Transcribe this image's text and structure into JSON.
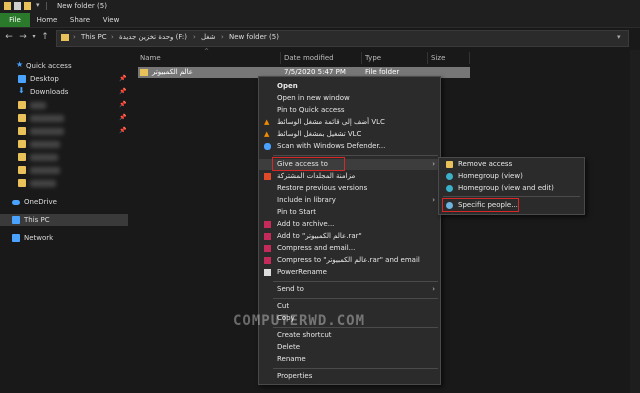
{
  "window": {
    "title": "New folder (5)"
  },
  "ribbon": {
    "tabs": [
      "File",
      "Home",
      "Share",
      "View"
    ]
  },
  "address": {
    "crumbs": [
      "This PC",
      "وحدة تخزين جديدة (F:)",
      "شغل",
      "New folder (5)"
    ]
  },
  "nav": {
    "quick_access": "Quick access",
    "desktop": "Desktop",
    "downloads": "Downloads",
    "onedrive": "OneDrive",
    "this_pc": "This PC",
    "network": "Network"
  },
  "columns": {
    "name": "Name",
    "date": "Date modified",
    "type": "Type",
    "size": "Size"
  },
  "file": {
    "name": "عالم الكمبيوتر",
    "date": "7/5/2020 5:47 PM",
    "type": "File folder"
  },
  "context_menu": {
    "open": "Open",
    "open_new_window": "Open in new window",
    "pin_quick_access": "Pin to Quick access",
    "vlc_add_playlist": "أضف إلى قائمة مشغل الوسائط VLC",
    "vlc_play": "تشغيل بمشغل الوسائط VLC",
    "scan_defender": "Scan with Windows Defender...",
    "give_access": "Give access to",
    "sync_shared": "مزامنة المجلدات المشتركة",
    "restore_versions": "Restore previous versions",
    "include_library": "Include in library",
    "pin_start": "Pin to Start",
    "add_archive": "Add to archive...",
    "add_rar": "Add to \"عالم الكمبيوتر.rar\"",
    "compress_email": "Compress and email...",
    "compress_rar_email": "Compress to \"عالم الكمبيوتر.rar\" and email",
    "powerrename": "PowerRename",
    "send_to": "Send to",
    "cut": "Cut",
    "copy": "Copy",
    "create_shortcut": "Create shortcut",
    "delete": "Delete",
    "rename": "Rename",
    "properties": "Properties"
  },
  "submenu": {
    "remove_access": "Remove access",
    "homegroup_view": "Homegroup (view)",
    "homegroup_view_edit": "Homegroup (view and edit)",
    "specific_people": "Specific people..."
  },
  "watermark": "COMPUTERWD.COM",
  "colors": {
    "file_tab": "#2b7a2b",
    "highlight": "#d62828",
    "folder": "#e8c15a"
  }
}
